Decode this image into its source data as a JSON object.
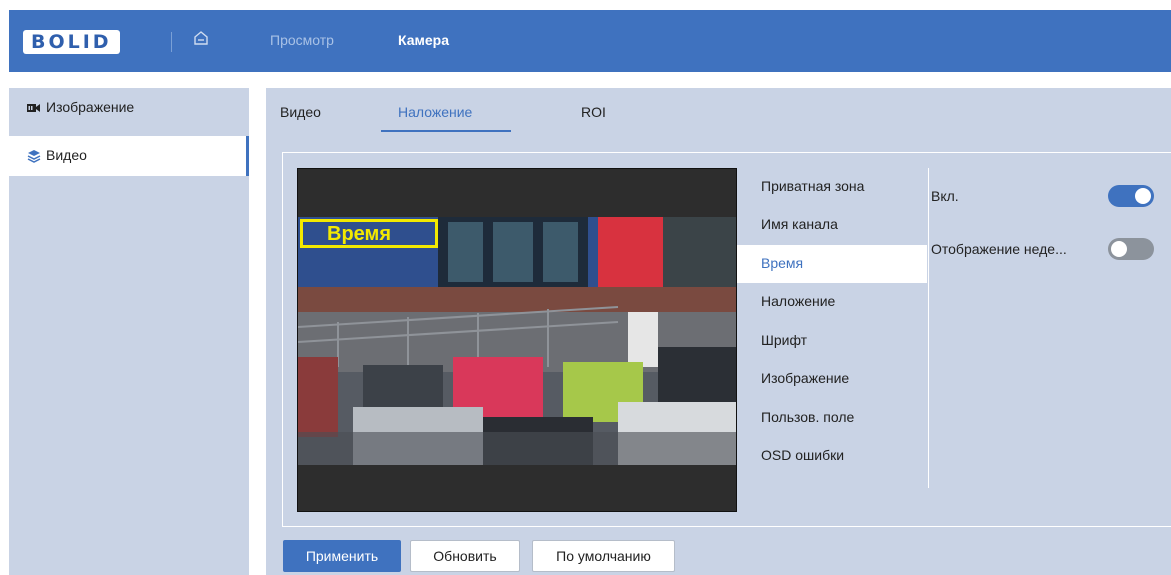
{
  "header": {
    "logo_text": "BOLID",
    "nav": [
      {
        "label": "Просмотр",
        "active": false
      },
      {
        "label": "Камера",
        "active": true
      }
    ]
  },
  "sidebar": {
    "items": [
      {
        "label": "Изображение",
        "icon": "camera-icon",
        "active": false
      },
      {
        "label": "Видео",
        "icon": "layers-icon",
        "active": true
      }
    ]
  },
  "tabs": [
    {
      "label": "Видео",
      "active": false
    },
    {
      "label": "Наложение",
      "active": true
    },
    {
      "label": "ROI",
      "active": false
    }
  ],
  "preview": {
    "overlay_label": "Время"
  },
  "overlay_menu": [
    {
      "label": "Приватная зона",
      "active": false
    },
    {
      "label": "Имя канала",
      "active": false
    },
    {
      "label": "Время",
      "active": true
    },
    {
      "label": "Наложение",
      "active": false
    },
    {
      "label": "Шрифт",
      "active": false
    },
    {
      "label": "Изображение",
      "active": false
    },
    {
      "label": "Пользов. поле",
      "active": false
    },
    {
      "label": "OSD ошибки",
      "active": false
    }
  ],
  "options": {
    "enable_label": "Вкл.",
    "enable_on": true,
    "weekday_label": "Отображение неде...",
    "weekday_on": false
  },
  "buttons": {
    "apply": "Применить",
    "refresh": "Обновить",
    "default": "По умолчанию"
  },
  "colors": {
    "accent": "#3f72bf",
    "overlay": "#f3e900",
    "toggle_off": "#8c939c"
  }
}
